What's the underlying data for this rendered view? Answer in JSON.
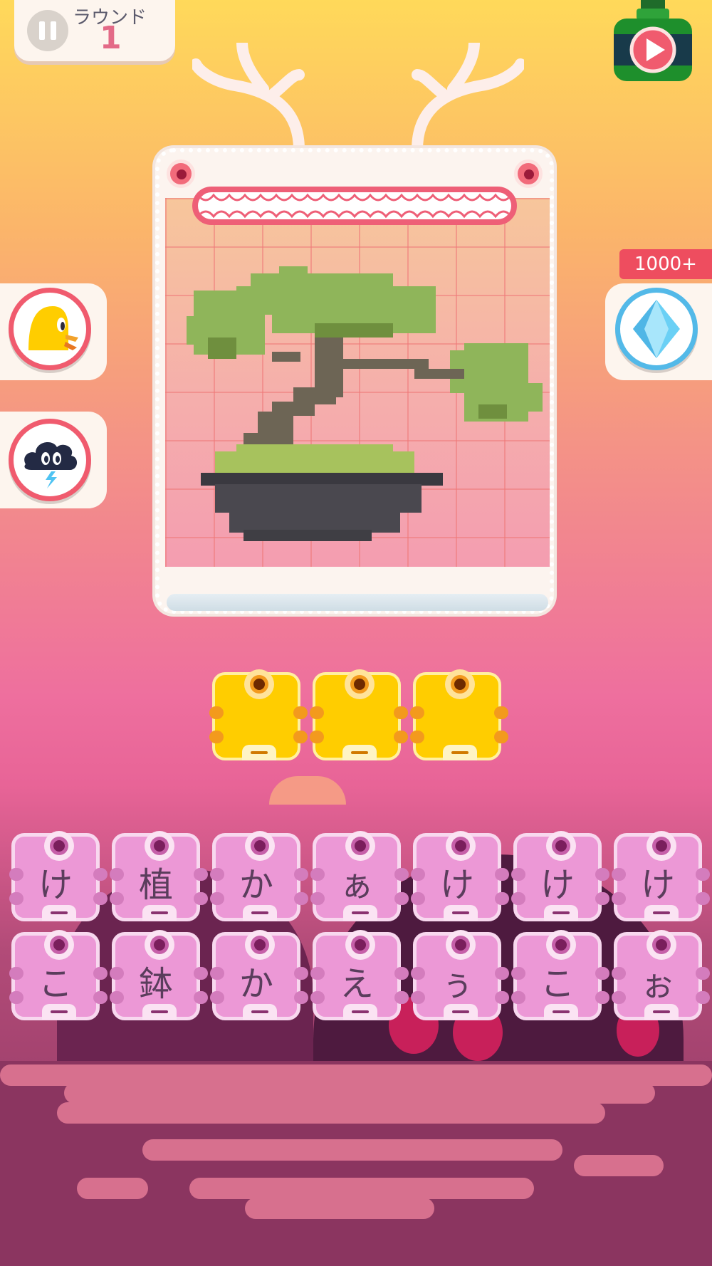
{
  "header": {
    "round_label": "ラウンド",
    "round_number": "1"
  },
  "side_buttons": {
    "gem_count": "1000+",
    "left": [
      {
        "icon": "yellow-bird-hint-icon"
      },
      {
        "icon": "storm-cloud-icon"
      }
    ],
    "right": [
      {
        "icon": "diamond-gem-icon"
      }
    ]
  },
  "puzzle": {
    "image": "bonsai-tree-pixel-art",
    "answer_slots": [
      "",
      "",
      ""
    ]
  },
  "letter_tiles": {
    "row1": [
      "け",
      "植",
      "か",
      "ぁ",
      "け",
      "け",
      "け"
    ],
    "row2": [
      "こ",
      "鉢",
      "か",
      "え",
      "ぅ",
      "こ",
      "ぉ"
    ]
  },
  "colors": {
    "accent_red": "#ee4d5f",
    "answer_tile": "#ffcd00",
    "letter_tile": "#ec98d6",
    "gem_blue": "#53b9e8"
  }
}
